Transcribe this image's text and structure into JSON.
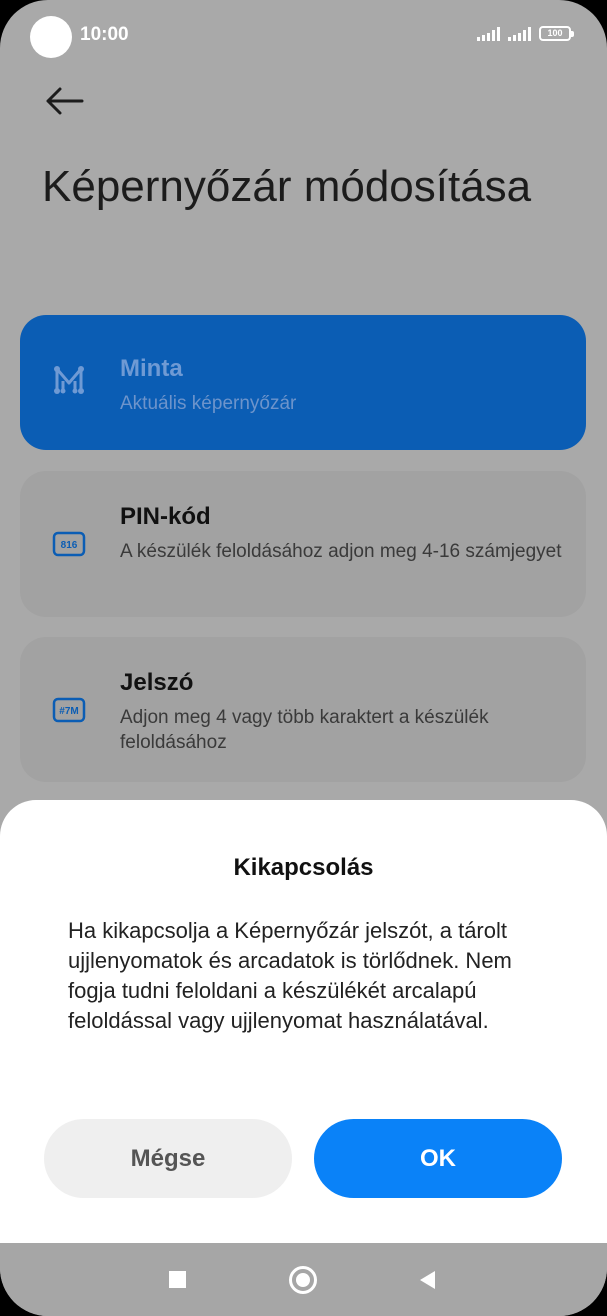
{
  "status_bar": {
    "time": "10:00",
    "battery": "100"
  },
  "page": {
    "title": "Képernyőzár módosítása"
  },
  "options": [
    {
      "title": "Minta",
      "subtitle": "Aktuális képernyőzár",
      "icon": "pattern-icon"
    },
    {
      "title": "PIN-kód",
      "subtitle": "A készülék feloldásához adjon meg 4-16 számjegyet",
      "icon_text": "816",
      "icon": "pin-icon"
    },
    {
      "title": "Jelszó",
      "subtitle": "Adjon meg 4 vagy több karaktert a készülék feloldásához",
      "icon_text": "#7M",
      "icon": "password-icon"
    }
  ],
  "dialog": {
    "title": "Kikapcsolás",
    "message": "Ha kikapcsolja a Képernyőzár jelszót, a tárolt ujjlenyomatok és arcadatok is törlődnek. Nem fogja tudni feloldani a készülékét arcalapú feloldással vagy ujjlenyomat használatával.",
    "cancel_label": "Mégse",
    "ok_label": "OK"
  },
  "colors": {
    "accent": "#0a82f8",
    "selected_card": "#0b5db4",
    "dim_overlay": "#a9a9a9"
  }
}
